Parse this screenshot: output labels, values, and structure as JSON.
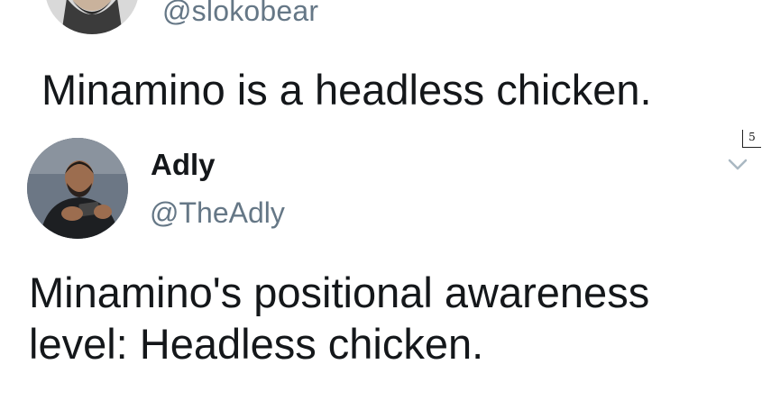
{
  "tweets": [
    {
      "handle": "@slokobear",
      "text": "Minamino is a headless chicken."
    },
    {
      "name": "Adly",
      "handle": "@TheAdly",
      "text": "Minamino's positional awareness level: Headless chicken."
    }
  ],
  "overlay": {
    "badge": "5"
  },
  "icons": {
    "caret": "chevron-down-icon",
    "avatar": "avatar"
  },
  "colors": {
    "text": "#14171a",
    "secondary": "#657786",
    "caret": "#aab8c2"
  }
}
